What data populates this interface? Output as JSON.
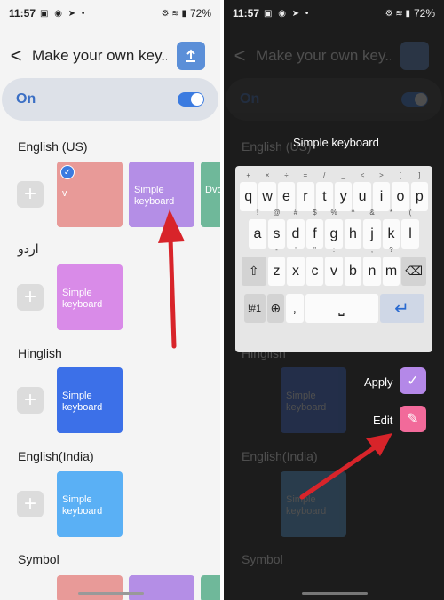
{
  "status": {
    "time": "11:57",
    "battery": "72%",
    "left_icons": "▣ ◉ ➤ •",
    "right_icons": "⚙ ≋ ▮"
  },
  "header": {
    "back": "<",
    "title": "Make your own key..."
  },
  "master": {
    "label": "On",
    "enabled": true
  },
  "sections": [
    {
      "name": "English (US)",
      "tiles": [
        {
          "label": "v",
          "color": "#e89a98",
          "selected": true
        },
        {
          "label": "Simple keyboard",
          "color": "#b48ee6",
          "selected": false
        },
        {
          "label": "Dvo key",
          "color": "#6fb89a",
          "selected": false
        }
      ]
    },
    {
      "name": "اردو",
      "tiles": [
        {
          "label": "Simple keyboard",
          "color": "#d98be8"
        }
      ]
    },
    {
      "name": "Hinglish",
      "tiles": [
        {
          "label": "Simple keyboard",
          "color": "#3c70e8"
        }
      ]
    },
    {
      "name": "English(India)",
      "tiles": [
        {
          "label": "Simple keyboard",
          "color": "#5ab0f5"
        }
      ]
    },
    {
      "name": "Symbol",
      "tiles": []
    }
  ],
  "preview": {
    "title": "Simple keyboard",
    "row1": [
      "q",
      "w",
      "e",
      "r",
      "t",
      "y",
      "u",
      "i",
      "o",
      "p"
    ],
    "row1_sub": [
      "+",
      "×",
      "÷",
      "=",
      "/",
      "_",
      "<",
      ">",
      "[",
      "]"
    ],
    "row2": [
      "a",
      "s",
      "d",
      "f",
      "g",
      "h",
      "j",
      "k",
      "l"
    ],
    "row2_sub": [
      "!",
      "@",
      "#",
      "$",
      "%",
      "^",
      "&",
      "*",
      "(",
      ")"
    ],
    "row3": [
      "z",
      "x",
      "c",
      "v",
      "b",
      "n",
      "m"
    ],
    "row3_sub": [
      "-",
      "'",
      "\"",
      ":",
      ";",
      ",",
      "?"
    ],
    "symbols_key": "!#1",
    "comma": ",",
    "apply_label": "Apply",
    "edit_label": "Edit"
  },
  "colors": {
    "apply": "#b488e8",
    "edit": "#f26a9a",
    "accent": "#3b7be0"
  }
}
